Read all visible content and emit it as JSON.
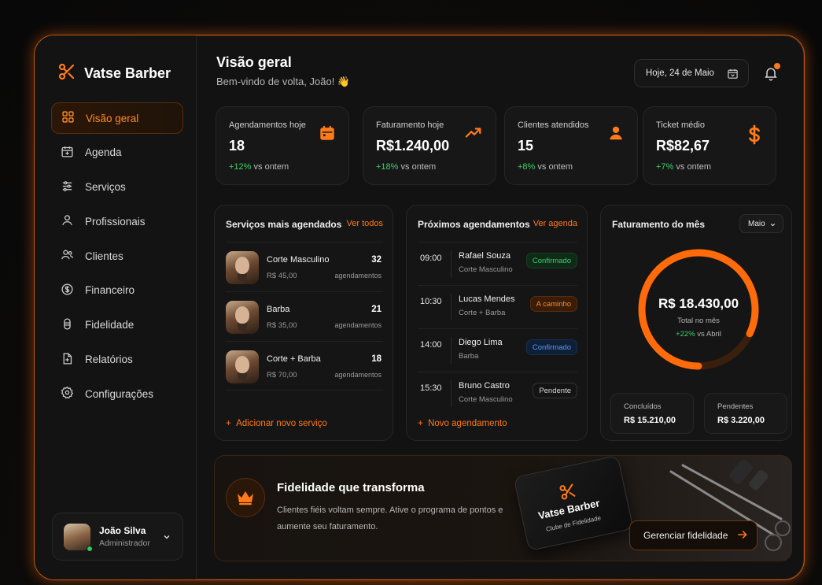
{
  "brand": {
    "name": "Vatse Barber"
  },
  "sidebar": {
    "items": [
      {
        "label": "Visão geral",
        "icon": "grid-icon",
        "active": true
      },
      {
        "label": "Agenda",
        "icon": "calendar-icon"
      },
      {
        "label": "Serviços",
        "icon": "sliders-icon"
      },
      {
        "label": "Profissionais",
        "icon": "user-icon"
      },
      {
        "label": "Clientes",
        "icon": "users-icon"
      },
      {
        "label": "Financeiro",
        "icon": "dollar-circle-icon"
      },
      {
        "label": "Fidelidade",
        "icon": "loyalty-icon"
      },
      {
        "label": "Relatórios",
        "icon": "report-icon"
      },
      {
        "label": "Configurações",
        "icon": "gear-icon"
      }
    ],
    "user": {
      "name": "João Silva",
      "role": "Administrador"
    }
  },
  "header": {
    "title": "Visão geral",
    "subtitle": "Bem-vindo de volta, João! 👋",
    "date": "Hoje, 24 de Maio"
  },
  "stats": [
    {
      "label": "Agendamentos hoje",
      "value": "18",
      "delta": "+12%",
      "delta_suffix": "vs ontem",
      "icon": "calendar-icon"
    },
    {
      "label": "Faturamento hoje",
      "value": "R$1.240,00",
      "delta": "+18%",
      "delta_suffix": "vs ontem",
      "icon": "trend-up-icon"
    },
    {
      "label": "Clientes atendidos",
      "value": "15",
      "delta": "+8%",
      "delta_suffix": "vs ontem",
      "icon": "user-icon"
    },
    {
      "label": "Ticket médio",
      "value": "R$82,67",
      "delta": "+7%",
      "delta_suffix": "vs ontem",
      "icon": "dollar-icon"
    }
  ],
  "services": {
    "title": "Serviços mais agendados",
    "link": "Ver todos",
    "unit": "agendamentos",
    "items": [
      {
        "name": "Corte Masculino",
        "price": "R$ 45,00",
        "count": "32"
      },
      {
        "name": "Barba",
        "price": "R$ 35,00",
        "count": "21"
      },
      {
        "name": "Corte + Barba",
        "price": "R$ 70,00",
        "count": "18"
      }
    ],
    "add": "Adicionar novo serviço"
  },
  "appointments": {
    "title": "Próximos agendamentos",
    "link": "Ver agenda",
    "items": [
      {
        "time": "09:00",
        "name": "Rafael Souza",
        "service": "Corte Masculino",
        "status": "Confirmado",
        "status_color": "#3ecf6c"
      },
      {
        "time": "10:30",
        "name": "Lucas Mendes",
        "service": "Corte + Barba",
        "status": "A caminho",
        "status_color": "#ff8a2a"
      },
      {
        "time": "14:00",
        "name": "Diego Lima",
        "service": "Barba",
        "status": "Confirmado",
        "status_color": "#5a9bff"
      },
      {
        "time": "15:30",
        "name": "Bruno Castro",
        "service": "Corte Masculino",
        "status": "Pendente",
        "status_color": "#d6d6d6"
      }
    ],
    "add": "Novo agendamento"
  },
  "revenue": {
    "title": "Faturamento do mês",
    "month": "Maio",
    "total": "R$ 18.430,00",
    "total_label": "Total no mês",
    "delta": "+22%",
    "delta_suffix": "vs Abril",
    "progress": 0.82,
    "concluded_label": "Concluídos",
    "concluded_value": "R$ 15.210,00",
    "pending_label": "Pendentes",
    "pending_value": "R$ 3.220,00"
  },
  "loyalty": {
    "title": "Fidelidade que transforma",
    "text": "Clientes fiéis voltam sempre. Ative o programa de pontos e aumente seu faturamento.",
    "card_name": "Vatse Barber",
    "card_sub": "Clube de Fidelidade",
    "button": "Gerenciar fidelidade"
  },
  "colors": {
    "accent": "#ff7a1a",
    "positive": "#3ecf6c",
    "background": "#121212"
  }
}
